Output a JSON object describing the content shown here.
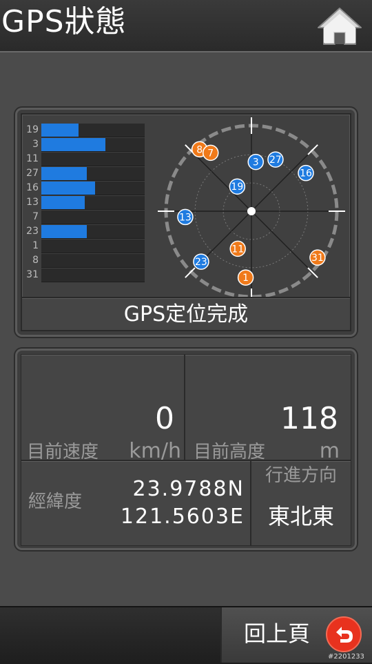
{
  "header": {
    "title": "GPS狀態",
    "home_icon": "home-icon"
  },
  "satellites": {
    "bars": [
      {
        "id": "19",
        "signal": 0.36
      },
      {
        "id": "3",
        "signal": 0.62
      },
      {
        "id": "11",
        "signal": 0.0
      },
      {
        "id": "27",
        "signal": 0.44
      },
      {
        "id": "16",
        "signal": 0.52
      },
      {
        "id": "13",
        "signal": 0.42
      },
      {
        "id": "7",
        "signal": 0.0
      },
      {
        "id": "23",
        "signal": 0.44
      },
      {
        "id": "1",
        "signal": 0.0
      },
      {
        "id": "8",
        "signal": 0.0
      },
      {
        "id": "31",
        "signal": 0.0
      }
    ],
    "sky": [
      {
        "id": "8",
        "azimuth": 320,
        "elevation": 5,
        "color": "#f07a1a"
      },
      {
        "id": "7",
        "azimuth": 325,
        "elevation": 15,
        "color": "#f07a1a"
      },
      {
        "id": "3",
        "azimuth": 5,
        "elevation": 38,
        "color": "#1f7be0"
      },
      {
        "id": "27",
        "azimuth": 25,
        "elevation": 30,
        "color": "#1f7be0"
      },
      {
        "id": "16",
        "azimuth": 55,
        "elevation": 20,
        "color": "#1f7be0"
      },
      {
        "id": "19",
        "azimuth": 330,
        "elevation": 60,
        "color": "#1f7be0"
      },
      {
        "id": "13",
        "azimuth": 265,
        "elevation": 20,
        "color": "#1f7be0"
      },
      {
        "id": "23",
        "azimuth": 225,
        "elevation": 15,
        "color": "#1f7be0"
      },
      {
        "id": "11",
        "azimuth": 200,
        "elevation": 48,
        "color": "#f07a1a"
      },
      {
        "id": "31",
        "azimuth": 125,
        "elevation": 5,
        "color": "#f07a1a"
      },
      {
        "id": "1",
        "azimuth": 185,
        "elevation": 20,
        "color": "#f07a1a"
      }
    ],
    "status": "GPS定位完成",
    "blue": "#1f7be0",
    "orange": "#f07a1a"
  },
  "info": {
    "speed_value": "0",
    "speed_label": "目前速度",
    "speed_unit": "km/h",
    "altitude_value": "118",
    "altitude_label": "目前高度",
    "altitude_unit": "m",
    "coords_label": "經緯度",
    "latitude": "23.9788N",
    "longitude": "121.5603E",
    "heading_label": "行進方向",
    "heading_value": "東北東"
  },
  "footer": {
    "back_label": "回上頁",
    "back_icon": "return-arrow-icon"
  },
  "watermark": "#2201233"
}
